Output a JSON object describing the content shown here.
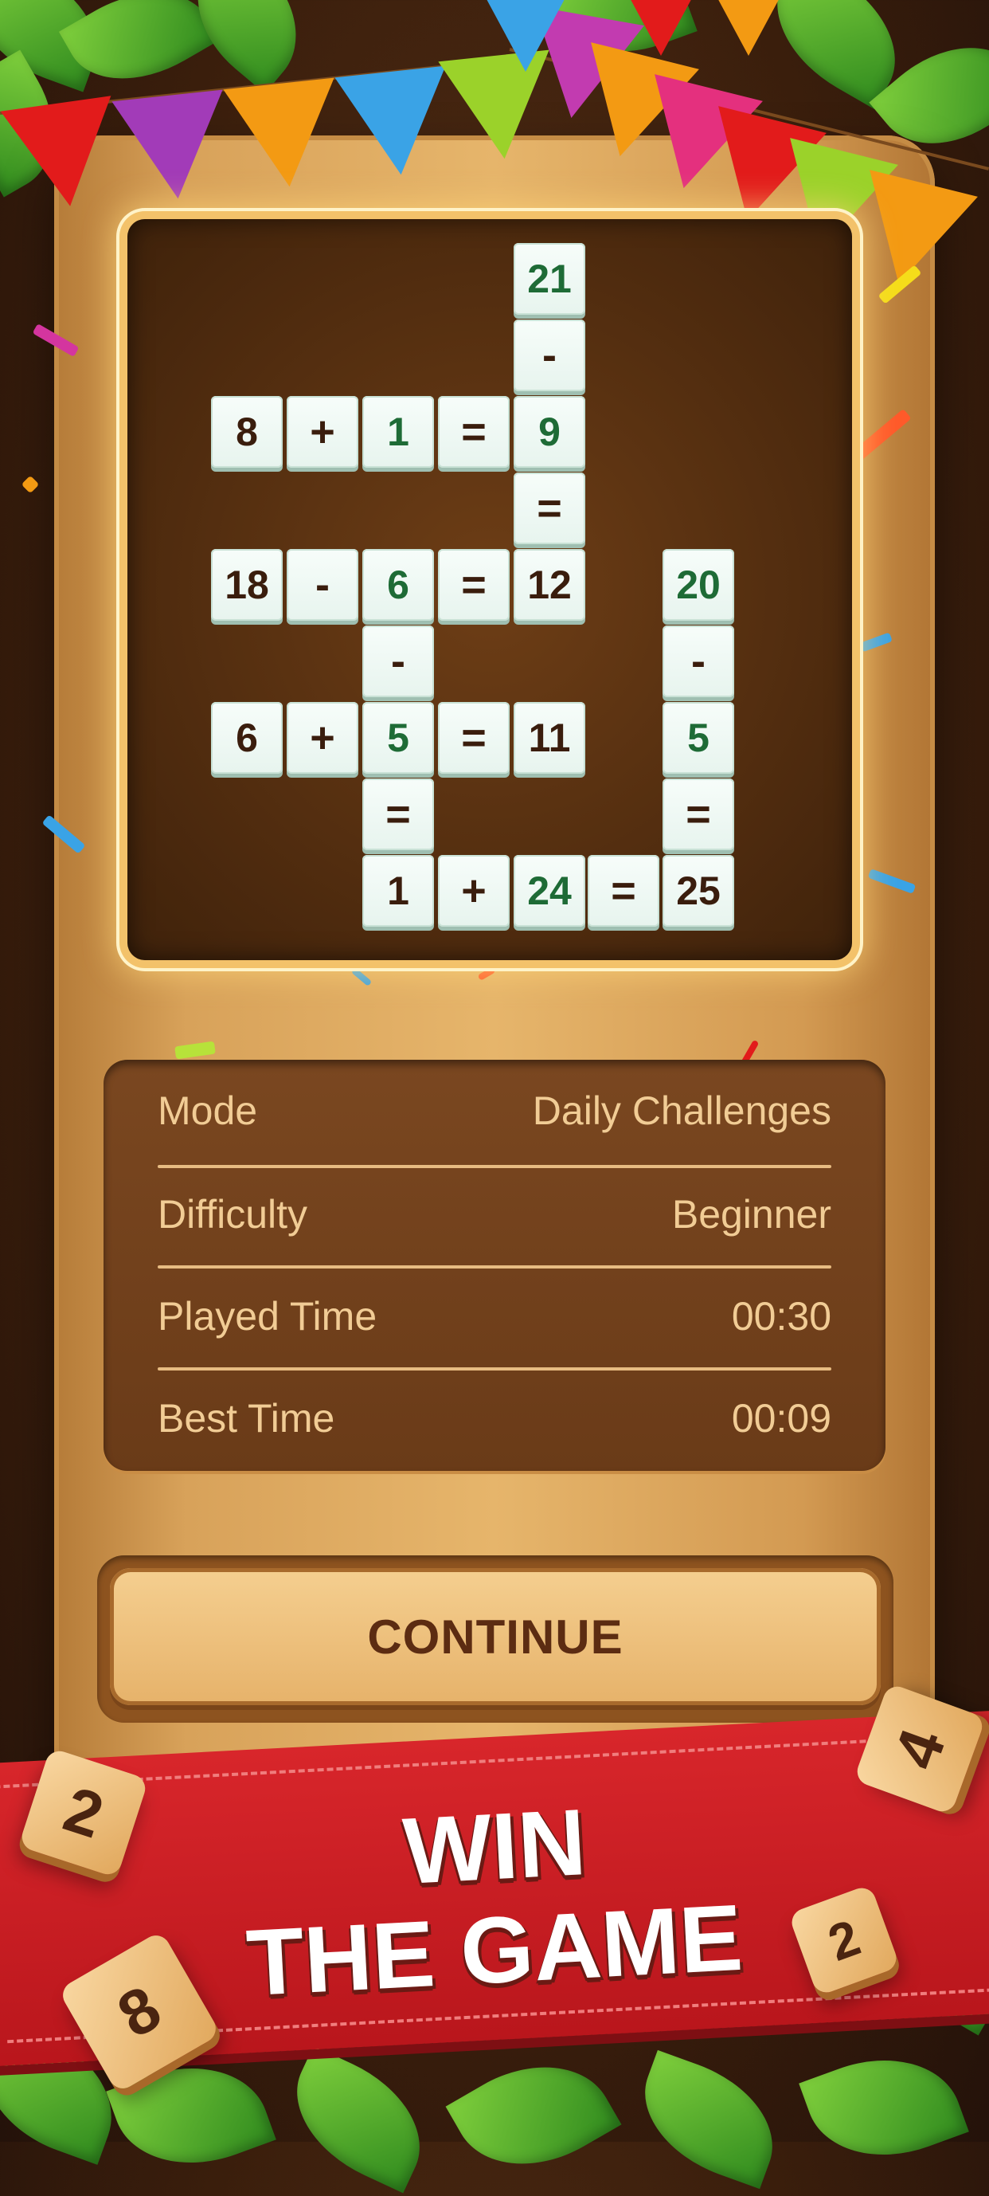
{
  "puzzle": {
    "tiles": [
      {
        "text": "21",
        "green": true
      },
      {
        "text": "-",
        "green": false
      },
      {
        "text": "8",
        "green": false
      },
      {
        "text": "+",
        "green": false
      },
      {
        "text": "1",
        "green": true
      },
      {
        "text": "=",
        "green": false
      },
      {
        "text": "9",
        "green": true
      },
      {
        "text": "=",
        "green": false
      },
      {
        "text": "18",
        "green": false
      },
      {
        "text": "-",
        "green": false
      },
      {
        "text": "6",
        "green": true
      },
      {
        "text": "=",
        "green": false
      },
      {
        "text": "12",
        "green": false
      },
      {
        "text": "20",
        "green": true
      },
      {
        "text": "-",
        "green": false
      },
      {
        "text": "-",
        "green": false
      },
      {
        "text": "6",
        "green": false
      },
      {
        "text": "+",
        "green": false
      },
      {
        "text": "5",
        "green": true
      },
      {
        "text": "=",
        "green": false
      },
      {
        "text": "11",
        "green": false
      },
      {
        "text": "5",
        "green": true
      },
      {
        "text": "=",
        "green": false
      },
      {
        "text": "=",
        "green": false
      },
      {
        "text": "1",
        "green": false
      },
      {
        "text": "+",
        "green": false
      },
      {
        "text": "24",
        "green": true
      },
      {
        "text": "=",
        "green": false
      },
      {
        "text": "25",
        "green": false
      }
    ]
  },
  "stats": {
    "mode_label": "Mode",
    "mode_value": "Daily Challenges",
    "difficulty_label": "Difficulty",
    "difficulty_value": "Beginner",
    "played_label": "Played Time",
    "played_value": "00:30",
    "best_label": "Best Time",
    "best_value": "00:09"
  },
  "continue_label": "CONTINUE",
  "banner": {
    "line1": "WIN",
    "line2": "THE GAME"
  },
  "dice": [
    "2",
    "4",
    "8",
    "2"
  ],
  "colors": {
    "ribbon": "#d8262b",
    "tile_green_text": "#1e6b36",
    "tile_dark_text": "#3a1d0d",
    "stats_text": "#f1cc95"
  }
}
